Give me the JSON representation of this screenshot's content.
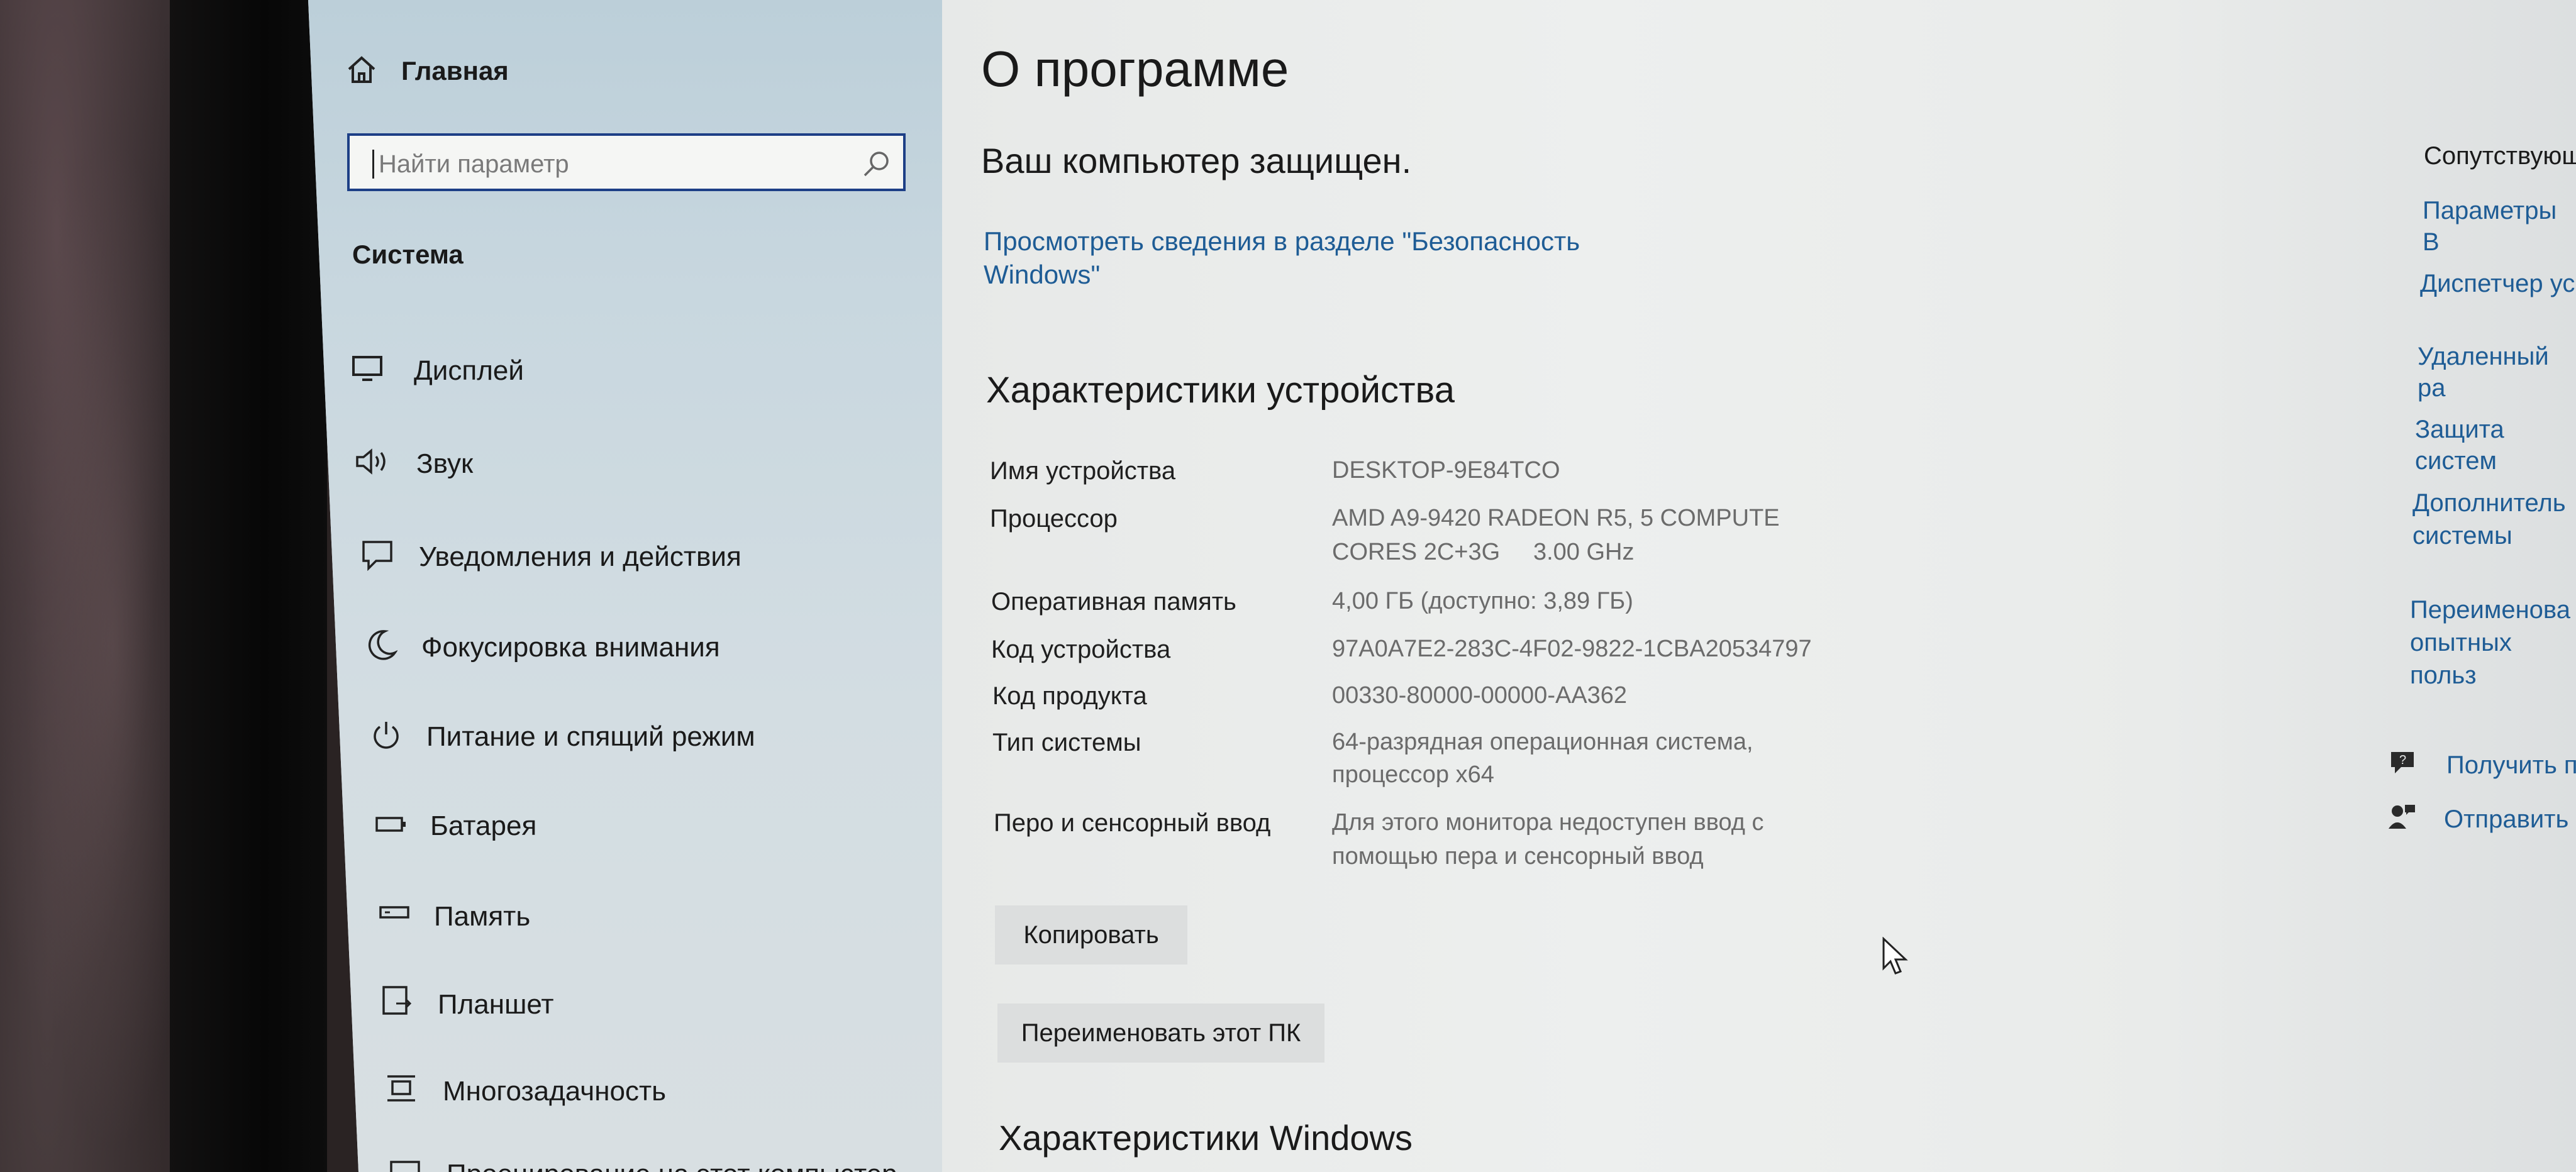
{
  "sidebar": {
    "home_label": "Главная",
    "search_placeholder": "Найти параметр",
    "section_title": "Система",
    "items": [
      {
        "label": "Дисплей",
        "icon": "monitor-icon"
      },
      {
        "label": "Звук",
        "icon": "speaker-icon"
      },
      {
        "label": "Уведомления и действия",
        "icon": "notifications-icon"
      },
      {
        "label": "Фокусировка внимания",
        "icon": "moon-icon"
      },
      {
        "label": "Питание и спящий режим",
        "icon": "power-icon"
      },
      {
        "label": "Батарея",
        "icon": "battery-icon"
      },
      {
        "label": "Память",
        "icon": "storage-icon"
      },
      {
        "label": "Планшет",
        "icon": "tablet-icon"
      },
      {
        "label": "Многозадачность",
        "icon": "multitasking-icon"
      },
      {
        "label": "Проецирование на этот компьютер",
        "icon": "projecting-icon"
      }
    ]
  },
  "main": {
    "page_title": "О программе",
    "protection_status": "Ваш компьютер защищен.",
    "security_link": [
      "Просмотреть сведения в разделе \"Безопасность",
      "Windows\""
    ],
    "device_specs_title": "Характеристики устройства",
    "specs": [
      {
        "label": "Имя устройства",
        "value": [
          "DESKTOP-9E84TCO"
        ]
      },
      {
        "label": "Процессор",
        "value": [
          "AMD A9-9420 RADEON R5, 5 COMPUTE",
          "CORES 2C+3G     3.00 GHz"
        ]
      },
      {
        "label": "Оперативная память",
        "value": [
          "4,00 ГБ (доступно: 3,89 ГБ)"
        ]
      },
      {
        "label": "Код устройства",
        "value": [
          "97A0A7E2-283C-4F02-9822-1CBA20534797"
        ]
      },
      {
        "label": "Код продукта",
        "value": [
          "00330-80000-00000-AA362"
        ]
      },
      {
        "label": "Тип системы",
        "value": [
          "64-разрядная операционная система,",
          "процессор x64"
        ]
      },
      {
        "label": "Перо и сенсорный ввод",
        "value": [
          "Для этого монитора недоступен ввод с",
          "помощью пера и сенсорный ввод"
        ]
      }
    ],
    "copy_button": "Копировать",
    "rename_button": "Переименовать этот ПК",
    "windows_specs_title": "Характеристики Windows"
  },
  "related": {
    "title": "Сопутствующ",
    "links": [
      [
        "Параметры B"
      ],
      [
        "Диспетчер ус"
      ],
      [
        "Удаленный ра"
      ],
      [
        "Защита систем"
      ],
      [
        "Дополнитель",
        "системы"
      ],
      [
        "Переименова",
        "опытных польз"
      ]
    ],
    "help": [
      {
        "label": "Получить п",
        "icon": "help-chat-icon"
      },
      {
        "label": "Отправить",
        "icon": "feedback-icon"
      }
    ]
  },
  "colors": {
    "link": "#1e5c95",
    "search_border": "#1d3f86",
    "sidebar_bg": "#c8d7df",
    "main_bg": "#eceeed"
  }
}
